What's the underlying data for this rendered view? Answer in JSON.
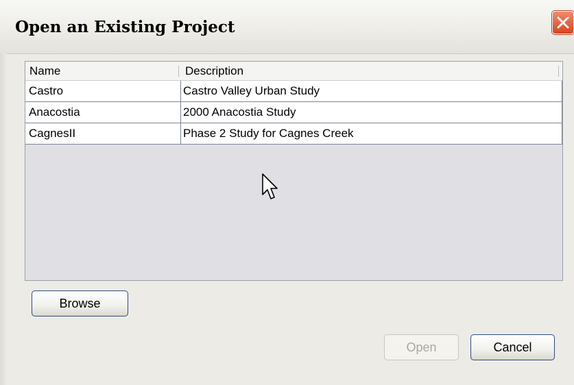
{
  "window": {
    "title": "Open an Existing Project"
  },
  "table": {
    "columns": [
      "Name",
      "Description"
    ],
    "rows": [
      {
        "name": "Castro",
        "description": "Castro Valley Urban Study"
      },
      {
        "name": "Anacostia",
        "description": "2000 Anacostia Study"
      },
      {
        "name": "CagnesII",
        "description": "Phase 2 Study for Cagnes Creek"
      }
    ]
  },
  "buttons": {
    "browse": "Browse",
    "open": "Open",
    "cancel": "Cancel"
  },
  "colors": {
    "close_button": "#d9451f",
    "dialog_background": "#ecebe5",
    "button_border": "#2f4a7c"
  }
}
